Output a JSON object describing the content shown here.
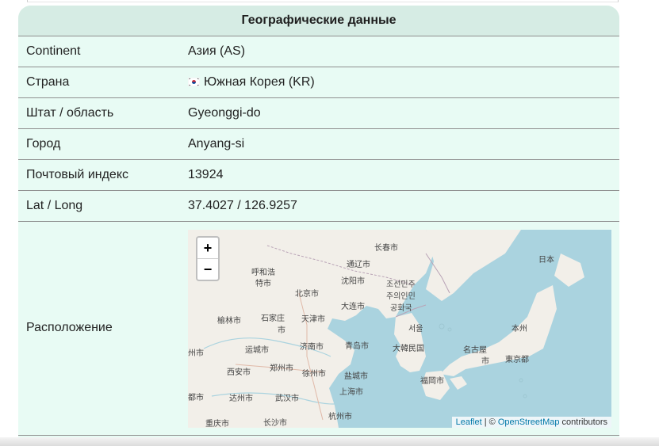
{
  "card": {
    "title": "Географические данные"
  },
  "rows": [
    {
      "key": "Continent",
      "value": "Азия (AS)"
    },
    {
      "key": "Страна",
      "value": "Южная Корея (KR)",
      "flag": "south-korea-flag"
    },
    {
      "key": "Штат / область",
      "value": "Gyeonggi-do"
    },
    {
      "key": "Город",
      "value": "Anyang-si"
    },
    {
      "key": "Почтовый индекс",
      "value": "13924"
    },
    {
      "key": "Lat / Long",
      "value": "37.4027 / 126.9257"
    }
  ],
  "location": {
    "key": "Расположение"
  },
  "map": {
    "zoom_in": "+",
    "zoom_out": "−",
    "attribution": {
      "leaflet": "Leaflet",
      "sep": " | © ",
      "osm": "OpenStreetMap",
      "suffix": " contributors"
    },
    "labels": [
      "长春市",
      "日本",
      "通辽市",
      "呼和浩",
      "特市",
      "沈阳市",
      "조선민주",
      "주의인민",
      "공화국",
      "北京市",
      "大连市",
      "榆林市",
      "石家庄",
      "市",
      "天津市",
      "서울",
      "本州",
      "大韓民国",
      "州市",
      "运城市",
      "济南市",
      "青岛市",
      "名古屋",
      "市",
      "東京都",
      "西安市",
      "郑州市",
      "徐州市",
      "盐城市",
      "福岡市",
      "都市",
      "达州市",
      "武汉市",
      "上海市",
      "重庆市",
      "长沙市",
      "杭州市"
    ],
    "colors": {
      "water": "#aad3df",
      "land": "#f2efe9"
    }
  }
}
